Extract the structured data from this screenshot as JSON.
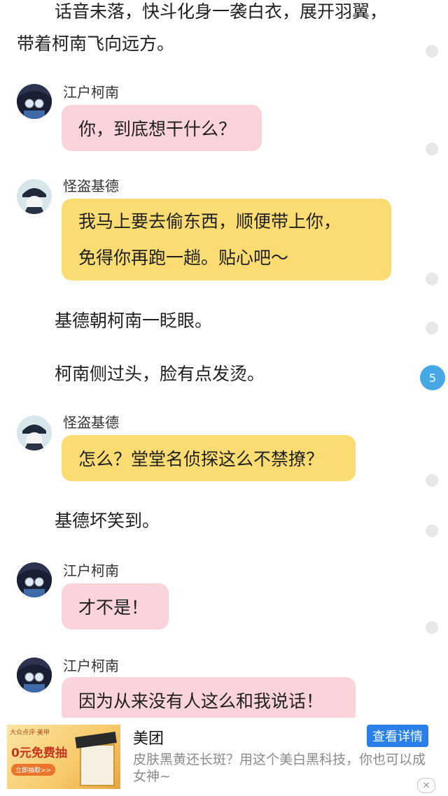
{
  "story": {
    "intro_line1": "话音未落，快斗化身一袭白衣，展开羽翼，",
    "intro_line2": "带着柯南飞向远方。",
    "messages": [
      {
        "speaker": "江户柯南",
        "text": "你，到底想干什么？"
      },
      {
        "speaker": "怪盗基德",
        "line1": "我马上要去偷东西，顺便带上你，",
        "line2": "免得你再跑一趟。贴心吧～"
      },
      {
        "narration": "基德朝柯南一眨眼。"
      },
      {
        "narration": "柯南侧过头，脸有点发烫。"
      },
      {
        "speaker": "怪盗基德",
        "text": "怎么？堂堂名侦探这么不禁撩？"
      },
      {
        "narration": "基德坏笑到。"
      },
      {
        "speaker": "江户柯南",
        "text": "才不是！"
      },
      {
        "speaker": "江户柯南",
        "text": "因为从来没有人这么和我说话！"
      }
    ],
    "comment_count": "5"
  },
  "colors": {
    "conan_bubble": "#fbd3da",
    "kid_bubble": "#fbdc72",
    "badge": "#46a8e4",
    "ad_button": "#2a80e8"
  },
  "ad": {
    "thumb_brand": "大众点评·美甲",
    "thumb_headline": "0元免费抽",
    "thumb_button": "立即抽取>>",
    "title": "美团",
    "description": "皮肤黑黄还长斑？用这个美白黑科技，你也可以成女神~",
    "cta": "查看详情",
    "close_icon": "close-icon"
  }
}
